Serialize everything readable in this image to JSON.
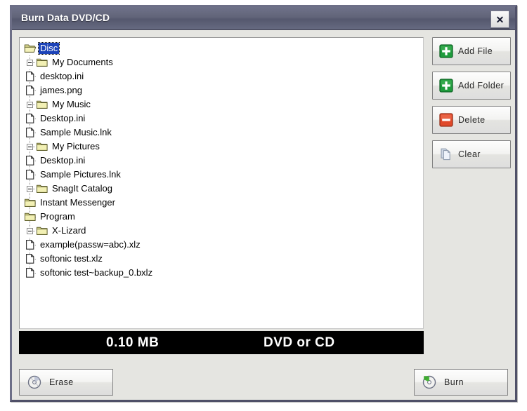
{
  "window": {
    "title": "Burn Data DVD/CD",
    "close_label": "✕"
  },
  "tree": {
    "root_label": "Disc",
    "nodes": [
      {
        "label": "Disc",
        "depth": 0,
        "icon": "open-folder-icon",
        "selected": true,
        "expandable": false
      },
      {
        "label": "My Documents",
        "depth": 1,
        "icon": "folder-icon",
        "selected": false,
        "expandable": true
      },
      {
        "label": "desktop.ini",
        "depth": 2,
        "icon": "file-icon",
        "selected": false,
        "expandable": false
      },
      {
        "label": "james.png",
        "depth": 2,
        "icon": "file-icon",
        "selected": false,
        "expandable": false
      },
      {
        "label": "My Music",
        "depth": 2,
        "icon": "folder-icon",
        "selected": false,
        "expandable": true
      },
      {
        "label": "Desktop.ini",
        "depth": 3,
        "icon": "file-icon",
        "selected": false,
        "expandable": false
      },
      {
        "label": "Sample Music.lnk",
        "depth": 3,
        "icon": "file-icon",
        "selected": false,
        "expandable": false
      },
      {
        "label": "My Pictures",
        "depth": 2,
        "icon": "folder-icon",
        "selected": false,
        "expandable": true
      },
      {
        "label": "Desktop.ini",
        "depth": 3,
        "icon": "file-icon",
        "selected": false,
        "expandable": false
      },
      {
        "label": "Sample Pictures.lnk",
        "depth": 3,
        "icon": "file-icon",
        "selected": false,
        "expandable": false
      },
      {
        "label": "SnagIt Catalog",
        "depth": 2,
        "icon": "folder-icon",
        "selected": false,
        "expandable": true
      },
      {
        "label": "Instant Messenger",
        "depth": 3,
        "icon": "folder-icon",
        "selected": false,
        "expandable": false
      },
      {
        "label": "Program",
        "depth": 3,
        "icon": "folder-icon",
        "selected": false,
        "expandable": false
      },
      {
        "label": "X-Lizard",
        "depth": 2,
        "icon": "folder-icon",
        "selected": false,
        "expandable": true
      },
      {
        "label": "example(passw=abc).xlz",
        "depth": 3,
        "icon": "file-icon",
        "selected": false,
        "expandable": false
      },
      {
        "label": "softonic test.xlz",
        "depth": 3,
        "icon": "file-icon",
        "selected": false,
        "expandable": false
      },
      {
        "label": "softonic test~backup_0.bxlz",
        "depth": 3,
        "icon": "file-icon",
        "selected": false,
        "expandable": false
      }
    ]
  },
  "side_buttons": [
    {
      "label": "Add File",
      "icon": "green-plus-icon"
    },
    {
      "label": "Add Folder",
      "icon": "green-plus-icon"
    },
    {
      "label": "Delete",
      "icon": "red-minus-icon"
    },
    {
      "label": "Clear",
      "icon": "copy-pages-icon"
    }
  ],
  "status": {
    "size": "0.10 MB",
    "media": "DVD or CD"
  },
  "bottom_buttons": {
    "erase": {
      "label": "Erase",
      "icon": "erase-disc-icon"
    },
    "burn": {
      "label": "Burn",
      "icon": "burn-disc-icon"
    }
  },
  "colors": {
    "titlebar": "#61647a",
    "window_bg": "#e5e5e1",
    "selection": "#1c43b8",
    "status_bg": "#000000",
    "status_text": "#ffffff",
    "green_icon": "#1f9b3c",
    "red_icon": "#e0492a",
    "folder": "#e8e6a0"
  }
}
